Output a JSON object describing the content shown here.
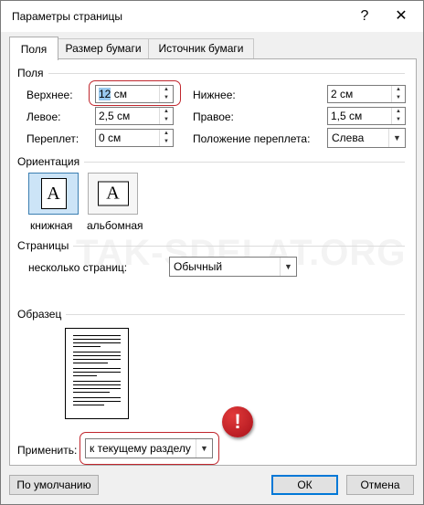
{
  "window": {
    "title": "Параметры страницы",
    "help_icon": "?",
    "close_icon": "✕"
  },
  "tabs": [
    {
      "label": "Поля",
      "active": true
    },
    {
      "label": "Размер бумаги",
      "active": false
    },
    {
      "label": "Источник бумаги",
      "active": false
    }
  ],
  "margins": {
    "section_label": "Поля",
    "top": {
      "label": "Верхнее:",
      "value": "12 см",
      "selected_part": "12",
      "rest": " см"
    },
    "bottom": {
      "label": "Нижнее:",
      "value": "2 см"
    },
    "left": {
      "label": "Левое:",
      "value": "2,5 см"
    },
    "right": {
      "label": "Правое:",
      "value": "1,5 см"
    },
    "gutter": {
      "label": "Переплет:",
      "value": "0 см"
    },
    "gutter_position": {
      "label": "Положение переплета:",
      "value": "Слева"
    }
  },
  "orientation": {
    "section_label": "Ориентация",
    "portrait": {
      "label": "книжная",
      "glyph": "A",
      "selected": true
    },
    "landscape": {
      "label": "альбомная",
      "glyph": "A",
      "selected": false
    }
  },
  "pages": {
    "section_label": "Страницы",
    "multiple_label": "несколько страниц:",
    "multiple_value": "Обычный"
  },
  "preview": {
    "section_label": "Образец"
  },
  "apply": {
    "label": "Применить:",
    "value": "к текущему разделу"
  },
  "warning_badge": "!",
  "buttons": {
    "default": "По умолчанию",
    "ok": "ОК",
    "cancel": "Отмена"
  },
  "watermark": "TAK-SDELAT.ORG",
  "colors": {
    "accent": "#0078d7",
    "highlight": "#c0262d",
    "selection": "#99c9ef"
  }
}
